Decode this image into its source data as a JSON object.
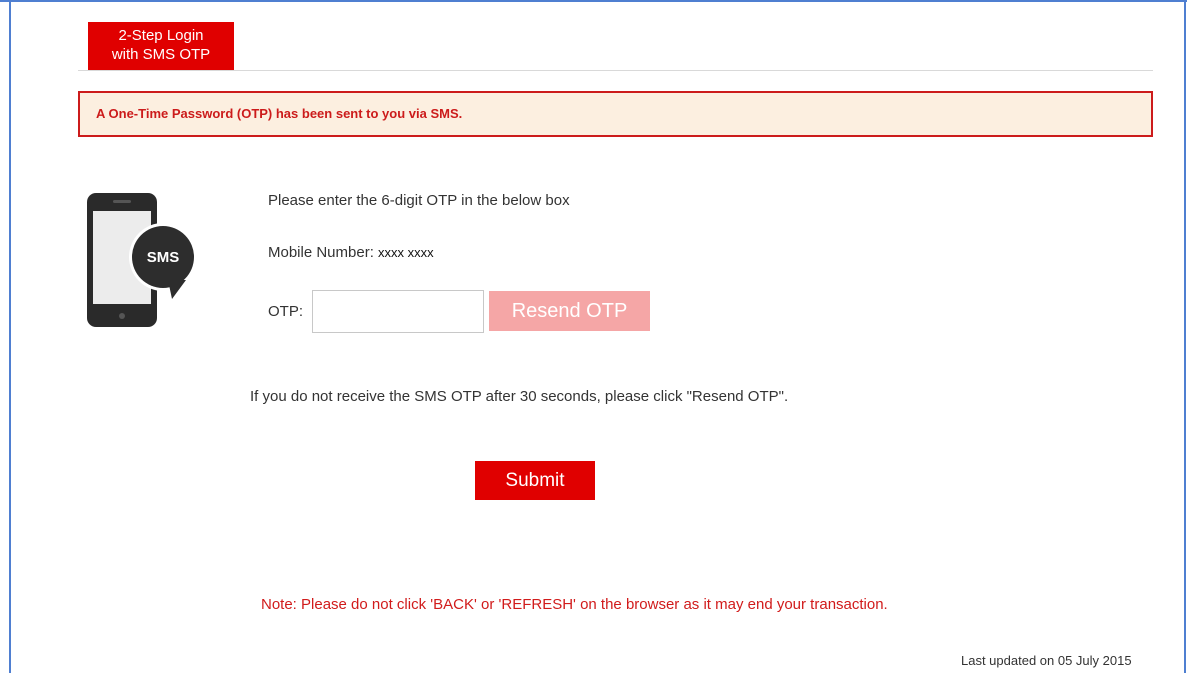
{
  "tab": {
    "line1": "2-Step Login",
    "line2": "with SMS OTP"
  },
  "alert": {
    "message": "A One-Time Password (OTP) has been sent to you via SMS."
  },
  "illustration": {
    "bubble_text": "SMS",
    "icon": "phone-sms-icon"
  },
  "form": {
    "instruction": "Please enter the 6-digit OTP in the below box",
    "mobile_label": "Mobile Number: ",
    "mobile_value": "xxxx xxxx",
    "otp_label": "OTP:",
    "otp_value": "",
    "resend_label": "Resend OTP",
    "hint": "If you do not receive the SMS OTP after 30 seconds, please click \"Resend OTP\".",
    "submit_label": "Submit"
  },
  "note": "Note: Please do not click 'BACK' or 'REFRESH' on the browser as it may end your transaction.",
  "footer": {
    "last_updated": "Last updated on 05 July 2015"
  },
  "colors": {
    "primary_red": "#e00000",
    "alert_bg": "#fcefe0",
    "alert_border": "#cc1b1b",
    "resend_bg": "#f5a6a6",
    "frame_blue": "#4f7fd1"
  }
}
